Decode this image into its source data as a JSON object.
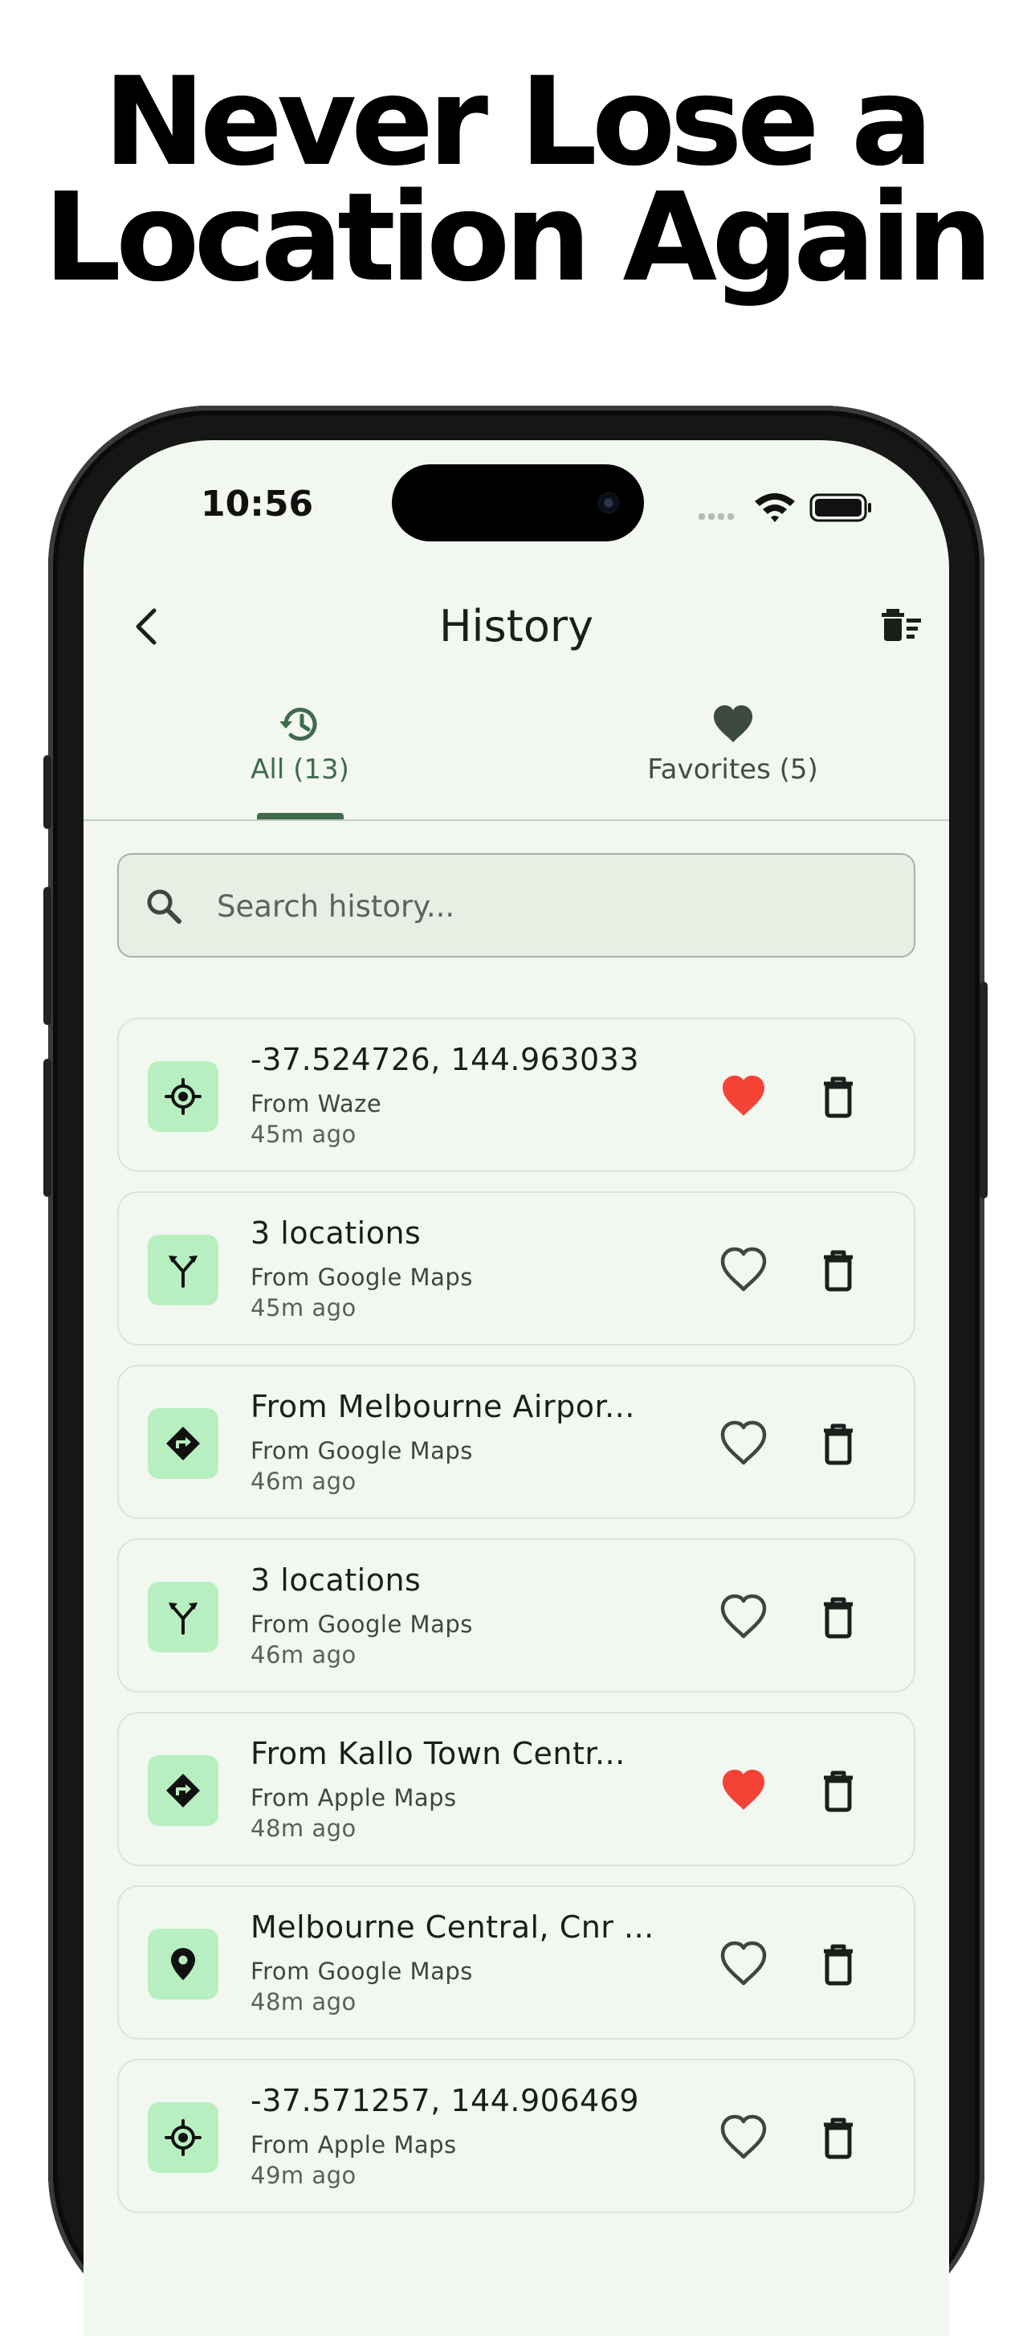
{
  "headline": {
    "line1": "Never Lose a",
    "line2": "Location Again"
  },
  "status_bar": {
    "time": "10:56"
  },
  "header": {
    "title": "History"
  },
  "tabs": [
    {
      "label": "All (13)",
      "icon": "history-icon",
      "selected": true
    },
    {
      "label": "Favorites (5)",
      "icon": "heart-icon",
      "selected": false
    }
  ],
  "search": {
    "placeholder": "Search history..."
  },
  "colors": {
    "accent": "#3e6b4d",
    "screen_bg": "#f2f7ef",
    "icon_tile": "#b8efc0",
    "favorite": "#f44336"
  },
  "history": [
    {
      "title": "-37.524726, 144.963033",
      "source": "From Waze",
      "time": "45m ago",
      "icon": "gps-target-icon",
      "favorite": true
    },
    {
      "title": "3 locations",
      "source": "From Google Maps",
      "time": "45m ago",
      "icon": "fork-route-icon",
      "favorite": false
    },
    {
      "title": "From Melbourne Airpor...",
      "source": "From Google Maps",
      "time": "46m ago",
      "icon": "directions-icon",
      "favorite": false
    },
    {
      "title": "3 locations",
      "source": "From Google Maps",
      "time": "46m ago",
      "icon": "fork-route-icon",
      "favorite": false
    },
    {
      "title": "From Kallo Town Centr...",
      "source": "From Apple Maps",
      "time": "48m ago",
      "icon": "directions-icon",
      "favorite": true
    },
    {
      "title": "Melbourne Central, Cnr ...",
      "source": "From Google Maps",
      "time": "48m ago",
      "icon": "place-pin-icon",
      "favorite": false
    },
    {
      "title": "-37.571257, 144.906469",
      "source": "From Apple Maps",
      "time": "49m ago",
      "icon": "gps-target-icon",
      "favorite": false
    }
  ]
}
